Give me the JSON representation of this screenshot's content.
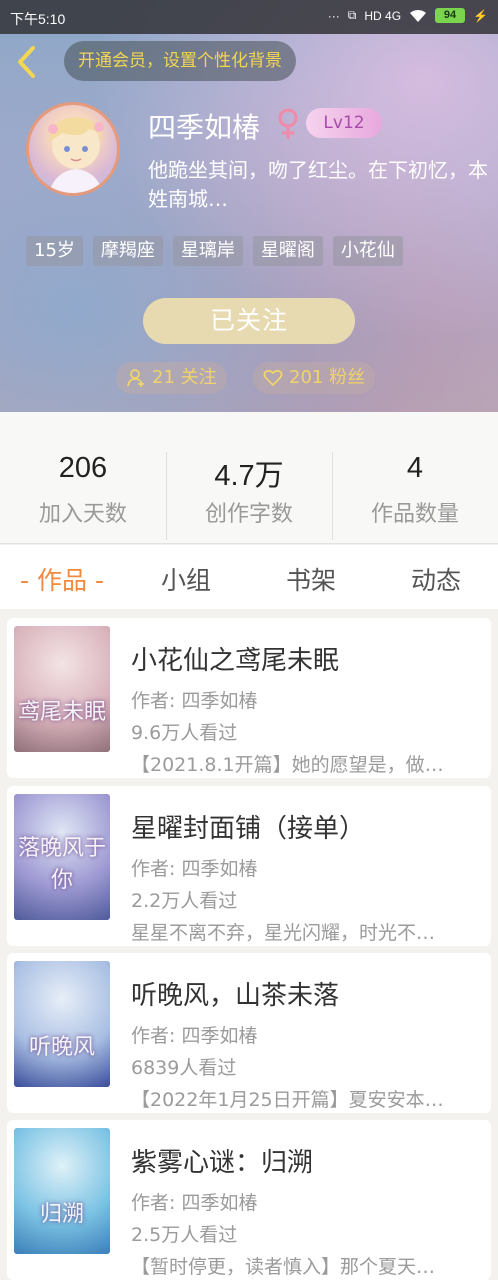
{
  "status_bar": {
    "time": "下午5:10",
    "network": "HD 4G",
    "battery": "94"
  },
  "header": {
    "vip_prompt": "开通会员，设置个性化背景",
    "username": "四季如椿",
    "gender_symbol": "♀",
    "level": "Lv12",
    "bio": "他跪坐其间，吻了红尘。在下初忆，本姓南城…",
    "tags": [
      "15岁",
      "摩羯座",
      "星璃岸",
      "星曜阁",
      "小花仙"
    ],
    "follow_button": "已关注",
    "following_label": "21 关注",
    "fans_label": "201 粉丝",
    "accent_color": "#f3d651"
  },
  "stats": [
    {
      "value": "206",
      "label": "加入天数"
    },
    {
      "value": "4.7万",
      "label": "创作字数"
    },
    {
      "value": "4",
      "label": "作品数量"
    }
  ],
  "tabs": [
    {
      "label": "- 作品 -",
      "active": true
    },
    {
      "label": "小组",
      "active": false
    },
    {
      "label": "书架",
      "active": false
    },
    {
      "label": "动态",
      "active": false
    }
  ],
  "works": [
    {
      "title": "小花仙之鸢尾未眠",
      "author": "作者: 四季如椿",
      "views": "9.6万人看过",
      "desc": "【2021.8.1开篇】她的愿望是，做…",
      "cover_text": "鸢尾未眠",
      "cover_colors": [
        "#f3e4e6",
        "#d9b3bc",
        "#8f6f79"
      ]
    },
    {
      "title": "星曜封面铺（接单）",
      "author": "作者: 四季如椿",
      "views": "2.2万人看过",
      "desc": "星星不离不弃，星光闪耀，时光不…",
      "cover_text": "落晚风于你",
      "cover_colors": [
        "#dfe6f5",
        "#9f9ad3",
        "#4f5b9a"
      ]
    },
    {
      "title": "听晚风，山茶未落",
      "author": "作者: 四季如椿",
      "views": "6839人看过",
      "desc": "【2022年1月25日开篇】夏安安本…",
      "cover_text": "听晚风",
      "cover_colors": [
        "#e7eef8",
        "#a9bfe3",
        "#3a4c9a"
      ]
    },
    {
      "title": "紫雾心谜：归溯",
      "author": "作者: 四季如椿",
      "views": "2.5万人看过",
      "desc": "【暂时停更，读者慎入】那个夏天…",
      "cover_text": "归溯",
      "cover_colors": [
        "#dff1f8",
        "#7cc3e4",
        "#3b7fb8"
      ]
    }
  ]
}
